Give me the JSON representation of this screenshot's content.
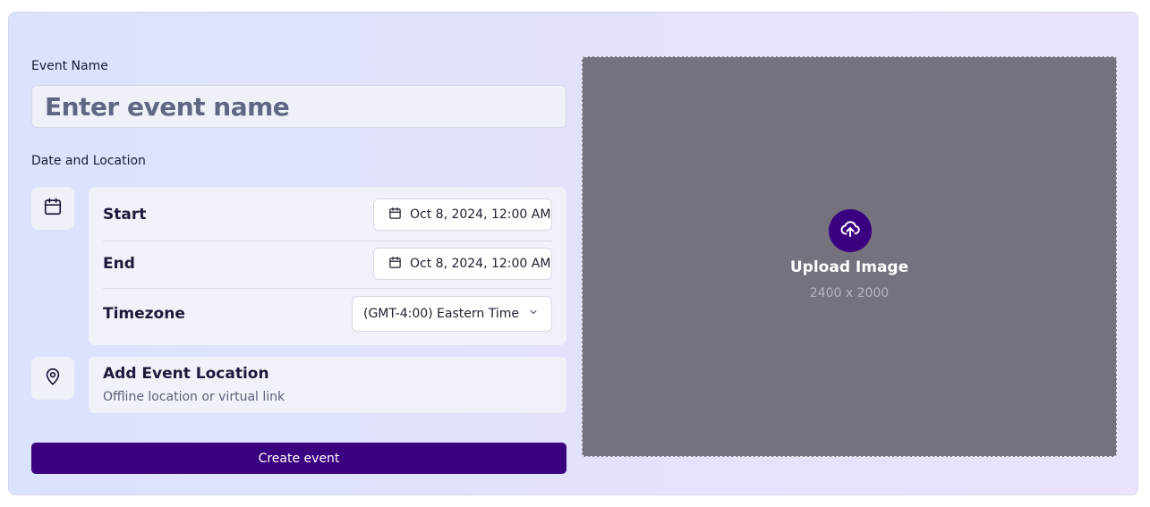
{
  "form": {
    "event_name_label": "Event Name",
    "event_name_placeholder": "Enter event name",
    "date_location_label": "Date and Location",
    "start_label": "Start",
    "start_value": "Oct 8, 2024, 12:00 AM",
    "end_label": "End",
    "end_value": "Oct 8, 2024, 12:00 AM",
    "timezone_label": "Timezone",
    "timezone_value": "(GMT-4:00) Eastern Time",
    "location_title": "Add Event Location",
    "location_subtitle": "Offline location or virtual link",
    "create_button": "Create event"
  },
  "upload": {
    "title": "Upload Image",
    "dimensions": "2400 x 2000"
  },
  "icons": {
    "calendar": "calendar-icon",
    "location": "map-pin-icon",
    "chevron": "chevron-down-icon",
    "upload": "cloud-upload-icon"
  },
  "colors": {
    "accent": "#3a0080",
    "upload_bg": "#75727e",
    "panel_bg": "#eff2f8"
  }
}
